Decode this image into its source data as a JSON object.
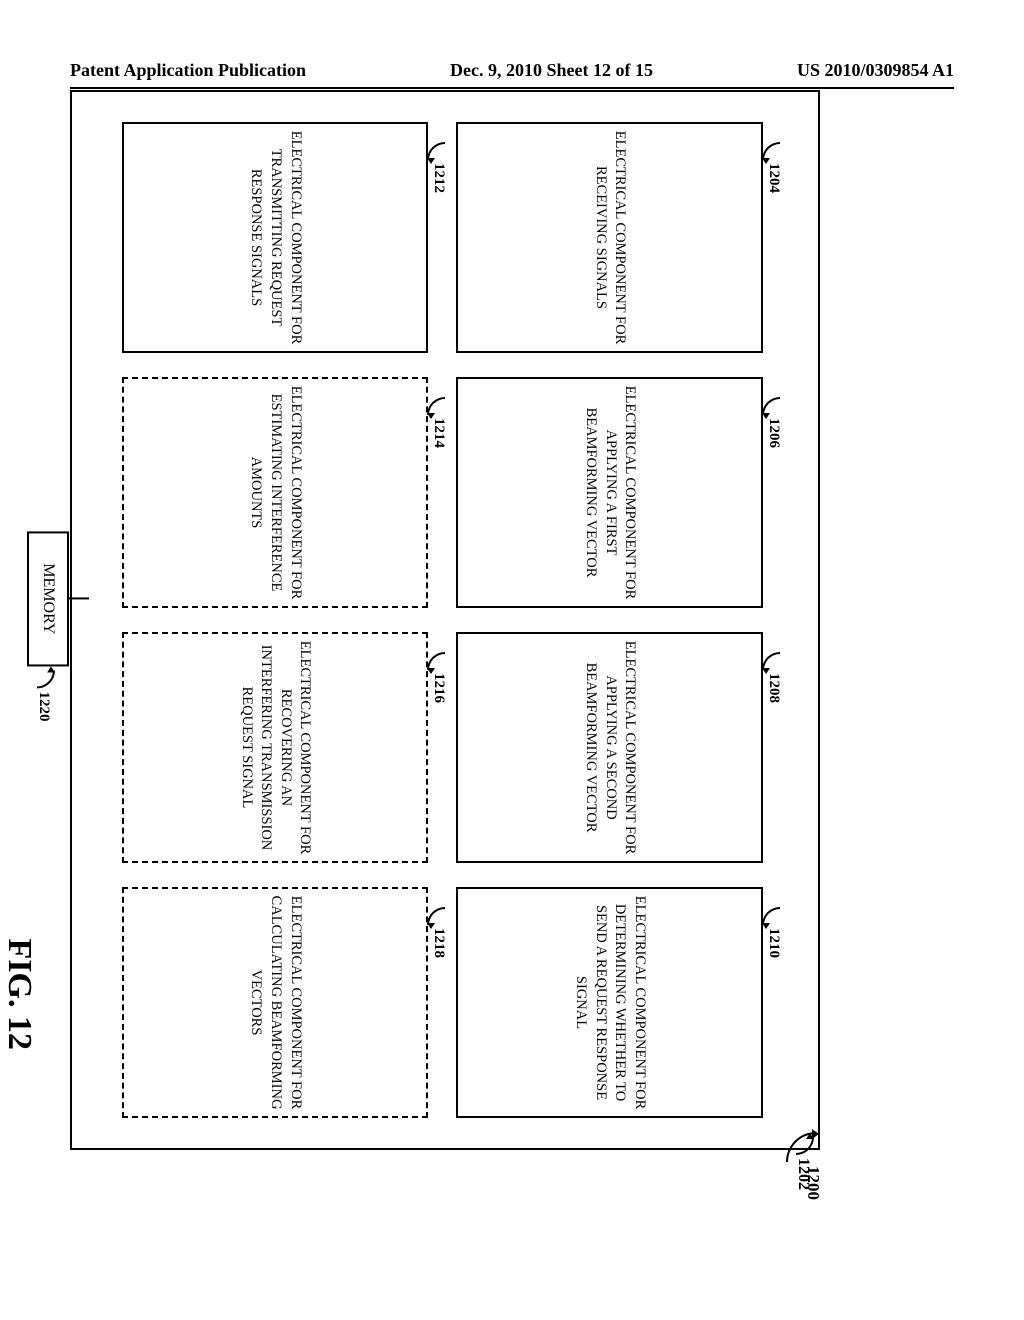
{
  "header": {
    "left": "Patent Application Publication",
    "center": "Dec. 9, 2010  Sheet 12 of 15",
    "right": "US 2010/0309854 A1"
  },
  "refs": {
    "r1200": "1200",
    "r1202": "1202",
    "r1204": "1204",
    "r1206": "1206",
    "r1208": "1208",
    "r1210": "1210",
    "r1212": "1212",
    "r1214": "1214",
    "r1216": "1216",
    "r1218": "1218",
    "r1220": "1220"
  },
  "blocks": {
    "b1204": "ELECTRICAL COMPONENT FOR RECEIVING SIGNALS",
    "b1206": "ELECTRICAL COMPONENT FOR APPLYING A FIRST BEAMFORMING VECTOR",
    "b1208": "ELECTRICAL COMPONENT FOR APPLYING A SECOND BEAMFORMING VECTOR",
    "b1210": "ELECTRICAL COMPONENT FOR DETERMINING WHETHER TO SEND A REQUEST RESPONSE SIGNAL",
    "b1212": "ELECTRICAL COMPONENT FOR TRANSMITTING REQUEST RESPONSE SIGNALS",
    "b1214": "ELECTRICAL COMPONENT FOR ESTIMATING INTERFERENCE AMOUNTS",
    "b1216": "ELECTRICAL COMPONENT FOR RECOVERING AN INTERFERING TRANSMISSION REQUEST SIGNAL",
    "b1218": "ELECTRICAL COMPONENT FOR CALCULATING BEAMFORMING VECTORS"
  },
  "memory": "MEMORY",
  "figure_label": "FIG. 12"
}
